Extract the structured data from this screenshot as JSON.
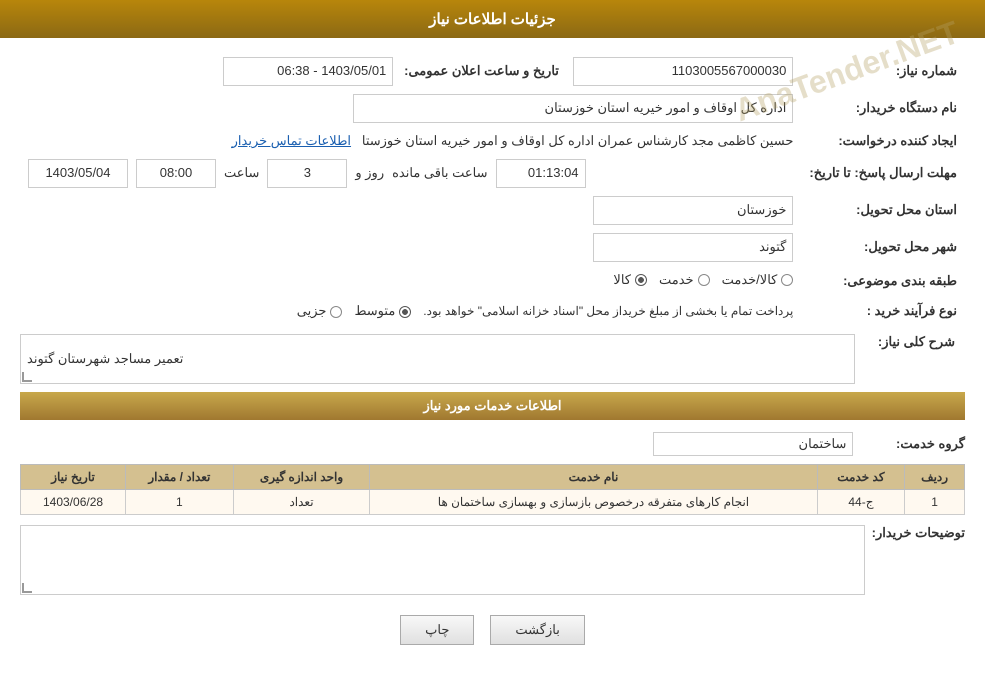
{
  "header": {
    "title": "جزئیات اطلاعات نیاز"
  },
  "fields": {
    "need_number_label": "شماره نیاز:",
    "need_number_value": "1103005567000030",
    "buyer_org_label": "نام دستگاه خریدار:",
    "buyer_org_value": "اداره کل اوقاف و امور خیریه استان خوزستان",
    "creator_label": "ایجاد کننده درخواست:",
    "creator_name": "حسین کاظمی مجد کارشناس عمران اداره کل اوقاف و امور خیریه استان خوزستا",
    "creator_link": "اطلاعات تماس خریدار",
    "deadline_label": "مهلت ارسال پاسخ: تا تاریخ:",
    "deadline_date": "1403/05/04",
    "deadline_time_label": "ساعت",
    "deadline_time": "08:00",
    "deadline_day_label": "روز و",
    "deadline_days": "3",
    "deadline_remaining_label": "ساعت باقی مانده",
    "deadline_remaining": "01:13:04",
    "announcement_label": "تاریخ و ساعت اعلان عمومی:",
    "announcement_value": "1403/05/01 - 06:38",
    "province_label": "استان محل تحویل:",
    "province_value": "خوزستان",
    "city_label": "شهر محل تحویل:",
    "city_value": "گتوند",
    "category_label": "طبقه بندی موضوعی:",
    "category_kala": "کالا",
    "category_khadamat": "خدمت",
    "category_kala_khadamat": "کالا/خدمت",
    "category_selected": "کالا",
    "process_label": "نوع فرآیند خرید :",
    "process_jozi": "جزیی",
    "process_motovaset": "متوسط",
    "process_note": "پرداخت تمام یا بخشی از مبلغ خریداز محل \"اسناد خزانه اسلامی\" خواهد بود.",
    "need_desc_label": "شرح کلی نیاز:",
    "need_desc_value": "تعمیر مساجد شهرستان گتوند",
    "services_section": "اطلاعات خدمات مورد نیاز",
    "service_group_label": "گروه خدمت:",
    "service_group_value": "ساختمان",
    "table": {
      "headers": [
        "ردیف",
        "کد خدمت",
        "نام خدمت",
        "واحد اندازه گیری",
        "تعداد / مقدار",
        "تاریخ نیاز"
      ],
      "rows": [
        {
          "row": "1",
          "code": "ج-44",
          "name": "انجام کارهای متفرقه درخصوص بازسازی و بهسازی ساختمان ها",
          "unit": "تعداد",
          "count": "1",
          "date": "1403/06/28"
        }
      ]
    },
    "buyer_notes_label": "توضیحات خریدار:",
    "buyer_notes_value": ""
  },
  "buttons": {
    "print_label": "چاپ",
    "back_label": "بازگشت"
  },
  "watermark": "AnaTender.NET"
}
